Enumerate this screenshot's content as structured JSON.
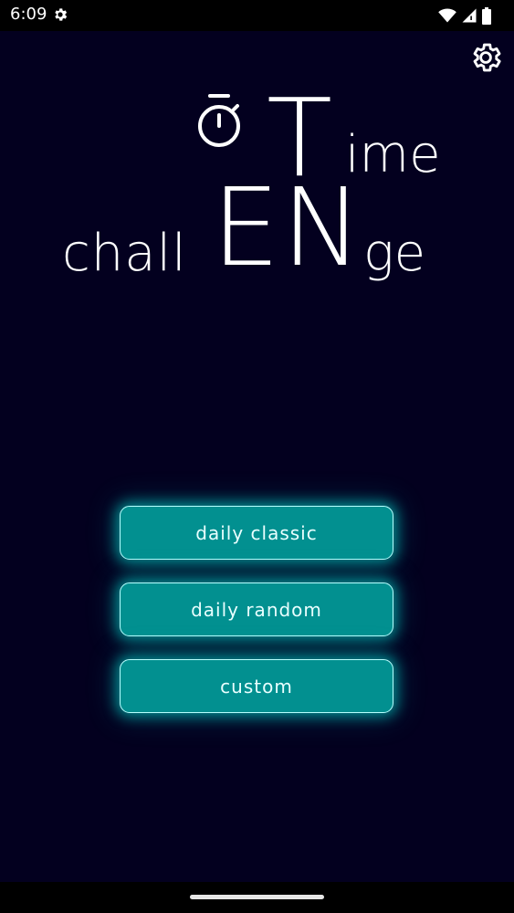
{
  "status_bar": {
    "time": "6:09",
    "icons": [
      "gear-icon",
      "wifi-icon",
      "signal-icon",
      "battery-icon"
    ]
  },
  "header": {
    "settings_icon": "gear-icon"
  },
  "logo": {
    "big_t": "T",
    "ime": "ime",
    "chall": "chall",
    "en": "EN",
    "ge": "ge",
    "icon": "stopwatch-icon"
  },
  "menu": {
    "items": [
      {
        "label": "daily classic"
      },
      {
        "label": "daily random"
      },
      {
        "label": "custom"
      }
    ]
  },
  "colors": {
    "background": "#03001f",
    "button_fill": "#029090",
    "button_border": "#b9ffff",
    "text": "#ffffff"
  }
}
